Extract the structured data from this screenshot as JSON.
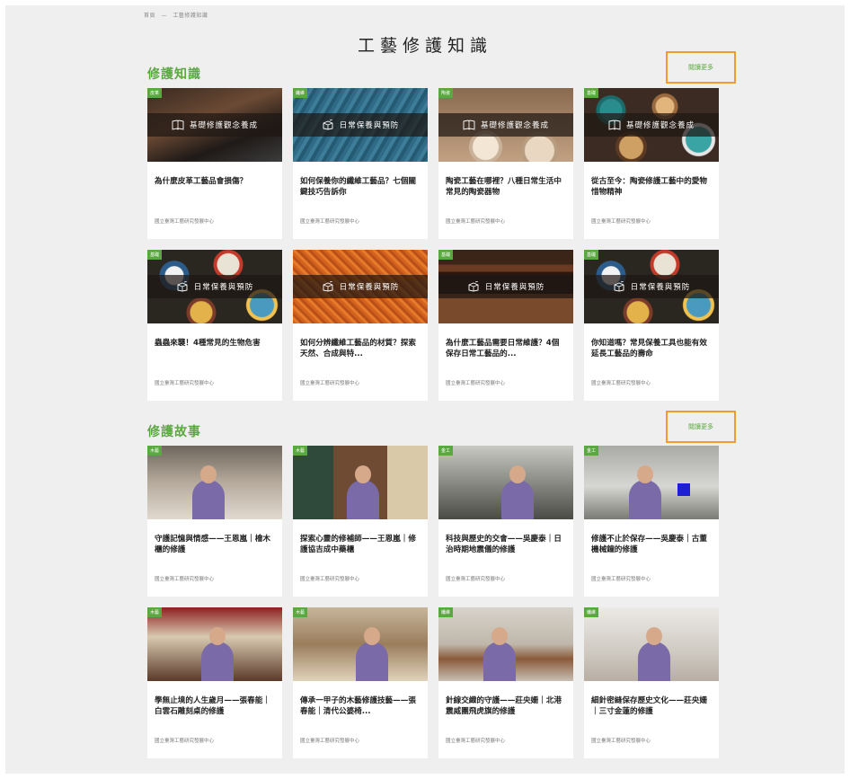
{
  "breadcrumb": [
    "首頁",
    "—",
    "工藝修護知識"
  ],
  "page_title": "工藝修護知識",
  "accent": "#5aa840",
  "highlight": "#f29a2e",
  "knowledge": {
    "title": "修護知識",
    "more_label": "閱讀更多",
    "cards": [
      {
        "tag": "皮革",
        "band": "基礎修護觀念養成",
        "icon": "book-icon",
        "scene": "sc-leather",
        "title": "為什麼皮革工藝品會損傷？",
        "org": "國立臺灣工藝研究發展中心"
      },
      {
        "tag": "纖維",
        "band": "日常保養與預防",
        "icon": "box-icon",
        "scene": "sc-fabric",
        "title": "如何保養你的纖維工藝品？七個關鍵技巧告訴你",
        "org": "國立臺灣工藝研究發展中心"
      },
      {
        "tag": "陶瓷",
        "band": "基礎修護觀念養成",
        "icon": "book-icon",
        "scene": "sc-pottery",
        "title": "陶瓷工藝在哪裡？八種日常生活中常見的陶瓷器物",
        "org": "國立臺灣工藝研究發展中心"
      },
      {
        "tag": "基礎",
        "band": "基礎修護觀念養成",
        "icon": "book-icon",
        "scene": "sc-bowls",
        "title": "從古至今：陶瓷修護工藝中的愛物惜物精神",
        "org": "國立臺灣工藝研究發展中心"
      },
      {
        "tag": "基礎",
        "band": "日常保養與預防",
        "icon": "box-icon",
        "scene": "sc-plates",
        "title": "蟲蟲來襲！4種常見的生物危害",
        "org": "國立臺灣工藝研究發展中心"
      },
      {
        "tag": "",
        "band": "日常保養與預防",
        "icon": "box-icon",
        "scene": "sc-orange",
        "title": "如何分辨纖維工藝品的材質？探索天然、合成與特...",
        "org": "國立臺灣工藝研究發展中心"
      },
      {
        "tag": "基礎",
        "band": "日常保養與預防",
        "icon": "box-icon",
        "scene": "sc-cabinet",
        "title": "為什麼工藝品需要日常維護？4個保存日常工藝品的...",
        "org": "國立臺灣工藝研究發展中心"
      },
      {
        "tag": "基礎",
        "band": "日常保養與預防",
        "icon": "box-icon",
        "scene": "sc-plates",
        "title": "你知道嗎？常見保養工具也能有效延長工藝品的壽命",
        "org": "國立臺灣工藝研究發展中心"
      }
    ]
  },
  "stories": {
    "title": "修護故事",
    "more_label": "閱讀更多",
    "cards": [
      {
        "tag": "木藝",
        "scene": "sc-lamp",
        "title": "守護記憶與情感——王恩嵐｜檜木櫃的修護",
        "org": "國立臺灣工藝研究發展中心"
      },
      {
        "tag": "木藝",
        "scene": "sc-shop",
        "title": "探索心靈的修補師——王恩嵐｜修護協吉成中藥櫃",
        "org": "國立臺灣工藝研究發展中心"
      },
      {
        "tag": "金工",
        "scene": "sc-lab",
        "title": "科技與歷史的交會——吳慶泰｜日治時期地震儀的修護",
        "org": "國立臺灣工藝研究發展中心"
      },
      {
        "tag": "金工",
        "scene": "sc-lab2",
        "title": "修護不止於保存——吳慶泰｜古董機械鐘的修護",
        "org": "國立臺灣工藝研究發展中心"
      },
      {
        "tag": "木藝",
        "scene": "sc-workshop",
        "title": "學無止境的人生歲月——張春能｜白雲石雕刻桌的修護",
        "org": "國立臺灣工藝研究發展中心"
      },
      {
        "tag": "木藝",
        "scene": "sc-carpentry",
        "title": "傳承一甲子的木藝修護技藝——張春能｜清代公婆椅...",
        "org": "國立臺灣工藝研究發展中心"
      },
      {
        "tag": "纖維",
        "scene": "sc-flag",
        "title": "針線交織的守護——莊央姍｜北港震威團飛虎旗的修護",
        "org": "國立臺灣工藝研究發展中心"
      },
      {
        "tag": "纖維",
        "scene": "sc-white",
        "title": "細針密縫保存歷史文化——莊央姍｜三寸金蓮的修護",
        "org": "國立臺灣工藝研究發展中心"
      }
    ]
  }
}
